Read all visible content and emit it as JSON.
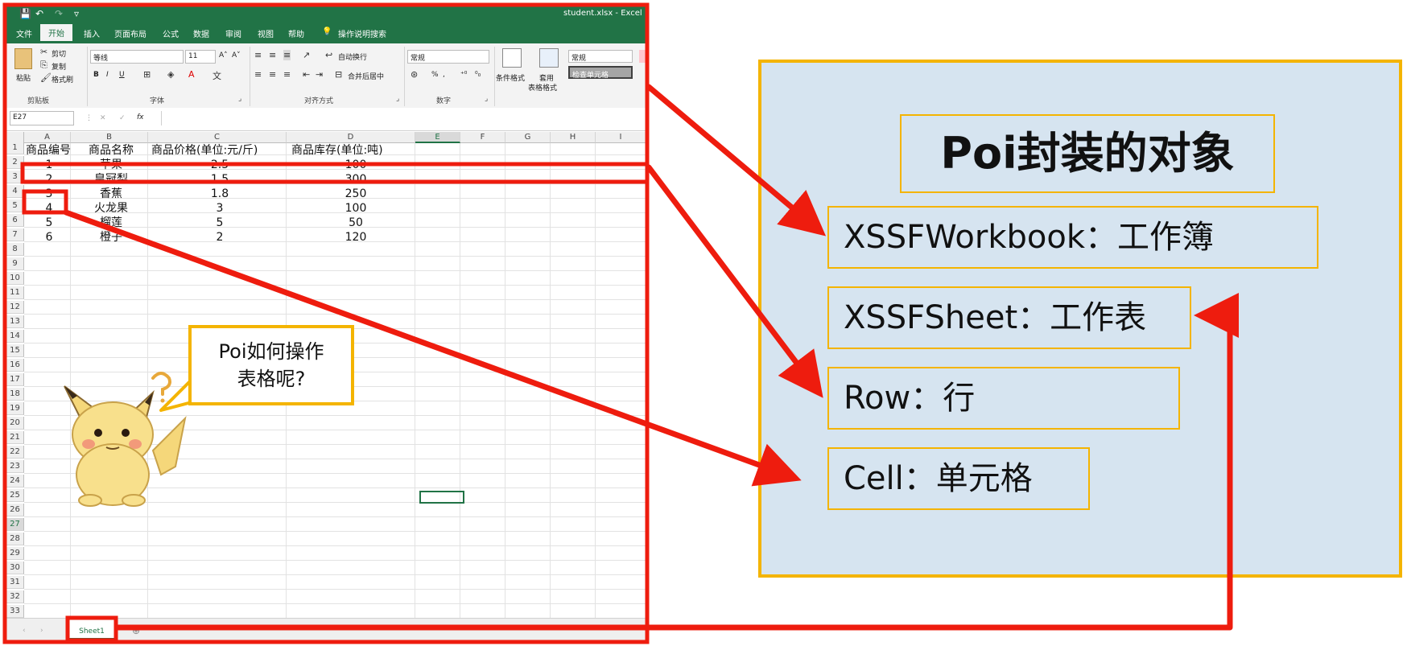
{
  "window": {
    "title": "student.xlsx - Excel",
    "quick_access": [
      "💾",
      "↶",
      "↷",
      "▿"
    ]
  },
  "ribbon_tabs": [
    "文件",
    "开始",
    "插入",
    "页面布局",
    "公式",
    "数据",
    "审阅",
    "视图",
    "帮助",
    "操作说明搜索"
  ],
  "ribbon": {
    "clipboard": {
      "paste": "粘贴",
      "cut": "剪切",
      "copy": "复制",
      "format_painter": "格式刷",
      "group": "剪贴板"
    },
    "font": {
      "name": "等线",
      "size": "11",
      "bold": "B",
      "italic": "I",
      "underline": "U",
      "group": "字体"
    },
    "alignment": {
      "wrap": "自动换行",
      "merge": "合并后居中",
      "group": "对齐方式"
    },
    "number": {
      "format": "常规",
      "percent": "%",
      "group": "数字"
    },
    "styles": {
      "conditional": "条件格式",
      "table_format_1": "套用",
      "table_format_2": "表格格式",
      "style_normal": "常规",
      "style_check": "检查单元格"
    }
  },
  "formula_bar": {
    "name_box": "E27",
    "fx": "fx",
    "value": ""
  },
  "grid": {
    "columns": [
      "A",
      "B",
      "C",
      "D",
      "E",
      "F",
      "G",
      "H",
      "I"
    ],
    "row_count": 37,
    "header": [
      "商品编号",
      "商品名称",
      "商品价格(单位:元/斤)",
      "商品库存(单位:吨)"
    ],
    "rows": [
      [
        "1",
        "苹果",
        "2.5",
        "100"
      ],
      [
        "2",
        "皇冠梨",
        "1.5",
        "300"
      ],
      [
        "3",
        "香蕉",
        "1.8",
        "250"
      ],
      [
        "4",
        "火龙果",
        "3",
        "100"
      ],
      [
        "5",
        "榴莲",
        "5",
        "50"
      ],
      [
        "6",
        "橙子",
        "2",
        "120"
      ]
    ],
    "selected_cell": "E27"
  },
  "sheet_tabs": [
    "Sheet1"
  ],
  "bubble": {
    "line1": "Poi如何操作",
    "line2": "表格呢?"
  },
  "panel": {
    "title": "Poi封装的对象",
    "items": [
      {
        "key": "XSSFWorkbook",
        "sep": "：",
        "value": "工作簿"
      },
      {
        "key": "XSSFSheet",
        "sep": "：",
        "value": "工作表"
      },
      {
        "key": "Row",
        "sep": "：",
        "value": "行"
      },
      {
        "key": "Cell",
        "sep": "：",
        "value": "单元格"
      }
    ]
  },
  "colors": {
    "excel_green": "#217346",
    "annotation_red": "#ee1c0e",
    "panel_blue": "#d6e4f0",
    "border_yellow": "#f4b400"
  }
}
